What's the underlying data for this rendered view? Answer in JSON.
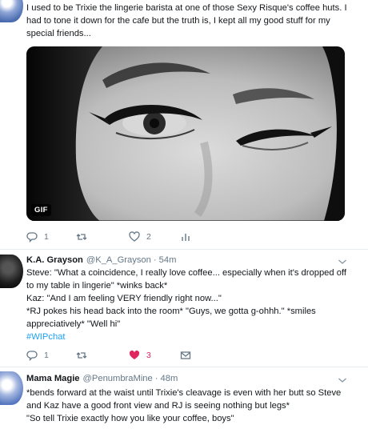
{
  "tweet1": {
    "text": "I used to be Trixie the lingerie barista at one of those Sexy Risque's coffee huts. I had to tone it down for the cafe but the truth is, I kept all my good stuff for my special friends...",
    "media_badge": "GIF",
    "reply_count": "1",
    "retweet_count": "",
    "like_count": "2"
  },
  "tweet2": {
    "name": "K.A. Grayson",
    "handle": "@K_A_Grayson",
    "time": "54m",
    "lines": [
      "Steve: \"What a coincidence, I really love coffee... especially when it's dropped off to my table in lingerie\" *winks back*",
      "Kaz: \"And I am feeling VERY friendly right now...\"",
      "*RJ pokes his head back into the room* \"Guys, we gotta g-ohhh.\" *smiles appreciatively* \"Well hi\""
    ],
    "hashtag": "#WIPchat",
    "reply_count": "1",
    "like_count": "3",
    "like_color": "#e0245e"
  },
  "tweet3": {
    "name": "Mama Magie",
    "handle": "@PenumbraMine",
    "time": "48m",
    "lines": [
      "*bends forward at the waist until Trixie's cleavage is even with her butt so Steve and Kaz have a good front view and RJ is seeing nothing but legs*",
      "\"So tell Trixie exactly how you like your coffee, boys\""
    ]
  },
  "separator": "·",
  "colors": {
    "link": "#1da1f2",
    "muted": "#657786",
    "like": "#e0245e",
    "divider": "#e6ecf0"
  }
}
